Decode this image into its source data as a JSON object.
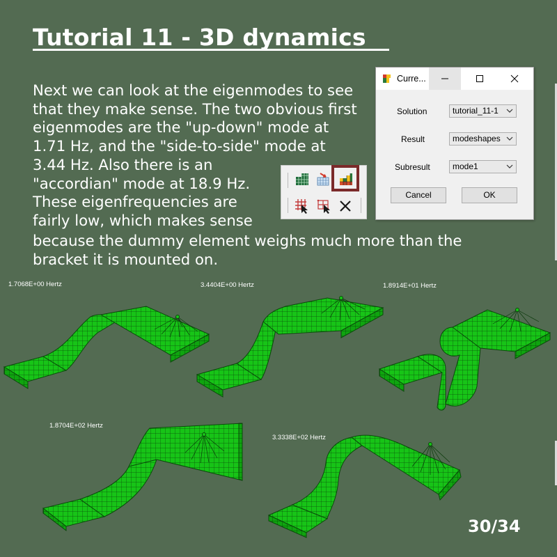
{
  "slide": {
    "title": "Tutorial 11 - 3D dynamics",
    "paragraph_lines_1": [
      "Next we can look at the eigenmodes to see",
      "that they make sense. The two obvious first",
      "eigenmodes are the \"up-down\" mode at",
      "1.71 Hz, and the \"side-to-side\" mode at",
      "3.44 Hz. Also there is an",
      "\"accordian\" mode at 18.9 Hz.",
      "These eigenfrequencies are",
      "fairly low, which makes sense"
    ],
    "paragraph_lines_2": [
      "because the dummy element weighs much more than the",
      "bracket it is mounted on."
    ],
    "page_number": "30/34"
  },
  "dialog": {
    "title": "Curre...",
    "fields": [
      {
        "label": "Solution",
        "value": "tutorial_11-1"
      },
      {
        "label": "Result",
        "value": "modeshapes"
      },
      {
        "label": "Subresult",
        "value": "mode1"
      }
    ],
    "cancel_label": "Cancel",
    "ok_label": "OK"
  },
  "toolbar": {
    "icons": [
      "mesh-plot-icon",
      "mesh-deform-icon",
      "result-plot-icon",
      "select-element-icon",
      "select-node-icon",
      "clear-icon"
    ],
    "highlighted": "result-plot-icon"
  },
  "modes": [
    {
      "caption": "1.7068E+00 Hertz"
    },
    {
      "caption": "3.4404E+00 Hertz"
    },
    {
      "caption": "1.8914E+01 Hertz"
    },
    {
      "caption": "1.8704E+02 Hertz"
    },
    {
      "caption": "3.3338E+02 Hertz"
    }
  ],
  "colors": {
    "background": "#536b52",
    "mesh_fill": "#17c417",
    "mesh_line": "#0a4a0a",
    "highlight_border": "#7b2a2a"
  }
}
